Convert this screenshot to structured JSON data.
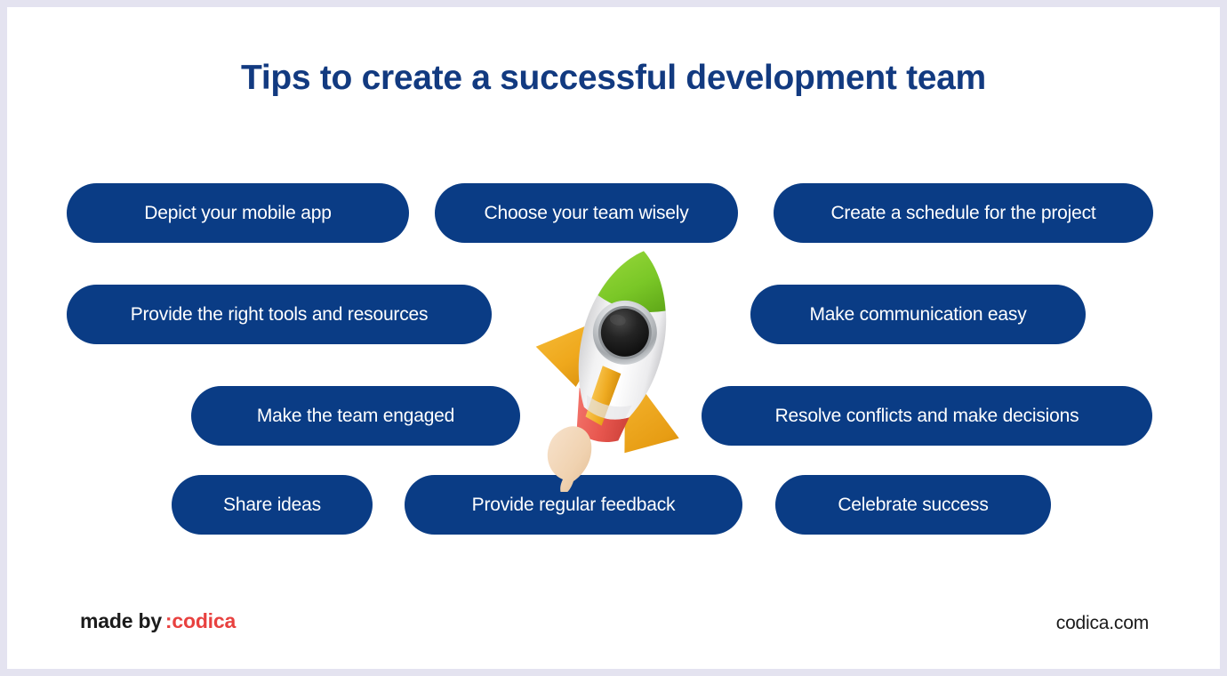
{
  "card": {
    "background": "#ffffff",
    "page_background": "#e4e3f0"
  },
  "header": {
    "title": "Tips to create a successful development team",
    "title_color": "#123a80"
  },
  "tips": {
    "pill_color": "#0a3c85",
    "pill_text_color": "#ffffff",
    "rows": [
      [
        {
          "label": "Depict your mobile app"
        },
        {
          "label": "Choose your team wisely"
        },
        {
          "label": "Create a schedule for the project"
        }
      ],
      [
        {
          "label": "Provide the right tools and resources"
        },
        {
          "label": "Make communication easy"
        }
      ],
      [
        {
          "label": "Make the team engaged"
        },
        {
          "label": "Resolve conflicts and make decisions"
        }
      ],
      [
        {
          "label": "Share ideas"
        },
        {
          "label": "Provide regular feedback"
        },
        {
          "label": "Celebrate success"
        }
      ]
    ],
    "flat": [
      "Depict your mobile app",
      "Choose your team wisely",
      "Create a schedule for the project",
      "Provide the right tools and resources",
      "Make communication easy",
      "Make the team engaged",
      "Resolve conflicts and make decisions",
      "Share ideas",
      "Provide regular feedback",
      "Celebrate success"
    ]
  },
  "illustration": {
    "name": "rocket-illustration",
    "body_color": "#ffffff",
    "nose_color": "#7ac727",
    "fin_color": "#f0a91e",
    "flame_base_color": "#e8574f",
    "porthole_color": "#1f1f1f",
    "porthole_ring_color": "#b9bcbf",
    "smoke_color": "#f1d4b4"
  },
  "footer": {
    "made_by_label": "made by",
    "brand": ":codica",
    "brand_color": "#e8413f",
    "website": "codica.com"
  }
}
